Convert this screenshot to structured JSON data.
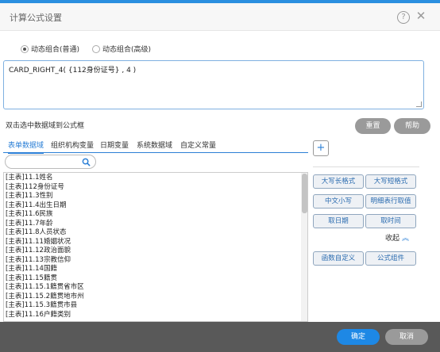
{
  "dialog": {
    "title": "计算公式设置",
    "help_icon": "?",
    "close_icon": "✕"
  },
  "mode": {
    "options": [
      {
        "label": "动态组合(普通)",
        "selected": true
      },
      {
        "label": "动态组合(高级)",
        "selected": false
      }
    ]
  },
  "formula": {
    "value": "CARD_RIGHT_4( {112身份证号} , 4 )"
  },
  "hint": "双击选中数据域到公式框",
  "actions": {
    "reset": "重置",
    "help": "帮助"
  },
  "tabs": [
    {
      "label": "表单数据域",
      "active": true
    },
    {
      "label": "组织机构变量",
      "active": false
    },
    {
      "label": "日期变量",
      "active": false
    },
    {
      "label": "系统数据域",
      "active": false
    },
    {
      "label": "自定义常量",
      "active": false
    }
  ],
  "plus_label": "+",
  "search": {
    "value": "",
    "placeholder": ""
  },
  "fields": [
    "[主表]11.1姓名",
    "[主表]112身份证号",
    "[主表]11.3性别",
    "[主表]11.4出生日期",
    "[主表]11.6民族",
    "[主表]11.7年龄",
    "[主表]11.8人员状态",
    "[主表]11.11婚姻状况",
    "[主表]11.12政治面貌",
    "[主表]11.13宗教信仰",
    "[主表]11.14国籍",
    "[主表]11.15籍贯",
    "[主表]11.15.1籍贯省市区",
    "[主表]11.15.2籍贯地市州",
    "[主表]11.15.3籍贯市县",
    "[主表]11.16户籍类别"
  ],
  "functions": [
    [
      "大写长格式",
      "大写短格式"
    ],
    [
      "中文小写",
      "明细表行取值"
    ],
    [
      "取日期",
      "取时间"
    ]
  ],
  "collapse_label": "收起",
  "functions2": [
    "函数自定义",
    "公式组件"
  ],
  "footer": {
    "ok": "确定",
    "cancel": "取消"
  },
  "colors": {
    "accent": "#1e88e5",
    "button_gray": "#9a9a9a",
    "footer_bg": "#595959"
  }
}
